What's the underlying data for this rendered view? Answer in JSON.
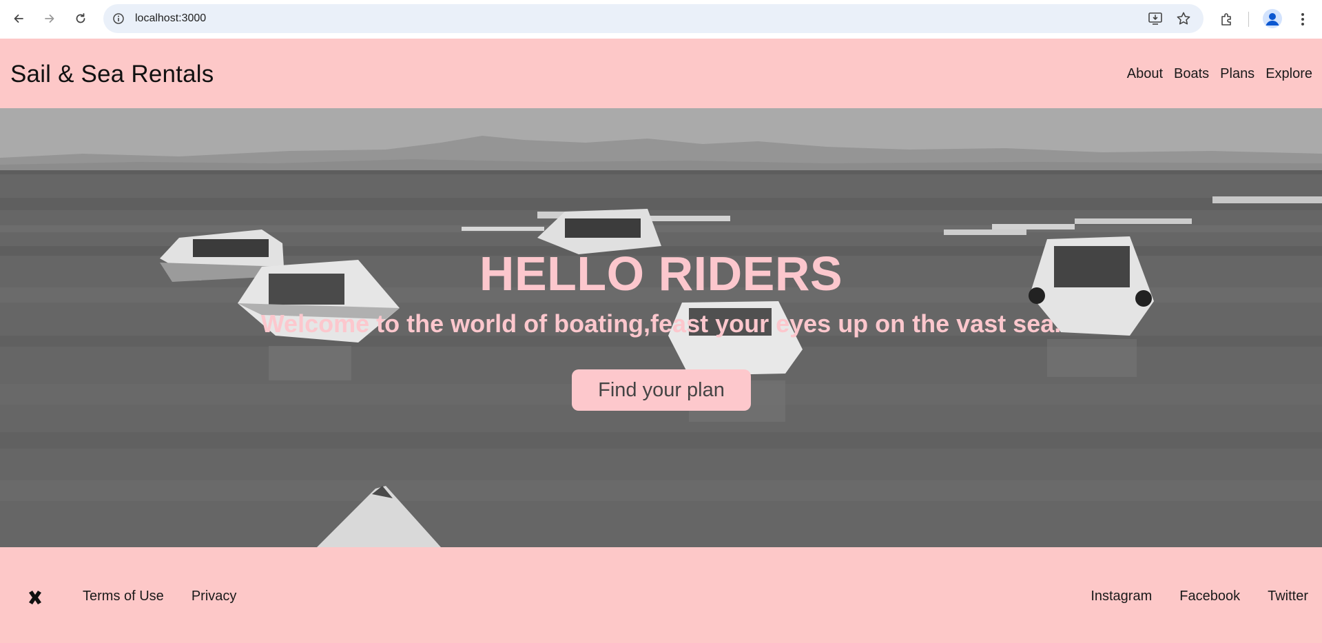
{
  "browser": {
    "url": "localhost:3000",
    "icons": [
      "back-icon",
      "forward-icon",
      "reload-icon",
      "site-info-icon",
      "install-app-icon",
      "bookmark-star-icon",
      "extensions-icon",
      "profile-icon",
      "kebab-menu-icon"
    ]
  },
  "header": {
    "brand": "Sail & Sea Rentals",
    "nav": [
      "About",
      "Boats",
      "Plans",
      "Explore"
    ]
  },
  "hero": {
    "title": "HELLO RIDERS",
    "subtitle": "Welcome to the world of boating,feast your eyes up on the vast sea.",
    "cta_label": "Find your plan"
  },
  "footer": {
    "logo_icon": "x-logo-icon",
    "left_links": [
      "Terms of Use",
      "Privacy"
    ],
    "right_links": [
      "Instagram",
      "Facebook",
      "Twitter"
    ]
  },
  "colors": {
    "header_bg": "#fdc8c8",
    "hero_text": "#fcc7cd",
    "cta_bg": "#fdc8cc",
    "omnibox_bg": "#eaf0f9"
  }
}
